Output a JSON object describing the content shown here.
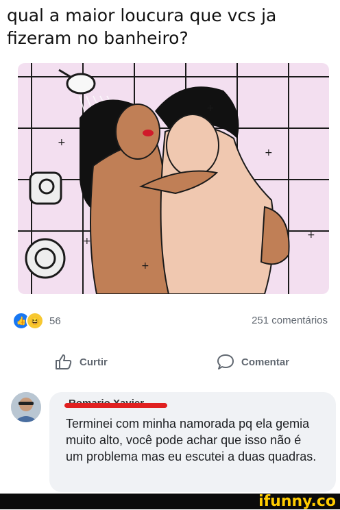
{
  "post": {
    "text": "qual a maior loucura que vcs ja fizeram no banheiro?"
  },
  "reactions": {
    "icons": [
      "like-icon",
      "haha-icon"
    ],
    "count": "56",
    "comments": "251 comentários"
  },
  "actions": {
    "like_label": "Curtir",
    "comment_label": "Comentar"
  },
  "comment": {
    "author": "Romario Xavier",
    "text": "Terminei com minha namorada pq ela gemia muito alto, você pode achar que isso não é um problema mas eu escutei a duas quadras."
  },
  "watermark": {
    "text": "ifunny.co"
  },
  "colors": {
    "like_blue": "#1877f2",
    "haha_yellow": "#f7c831",
    "bubble": "#f0f2f5",
    "tile_pink": "#f3dff0",
    "redact": "#e02020",
    "ifunny_yellow": "#ffcc00"
  }
}
